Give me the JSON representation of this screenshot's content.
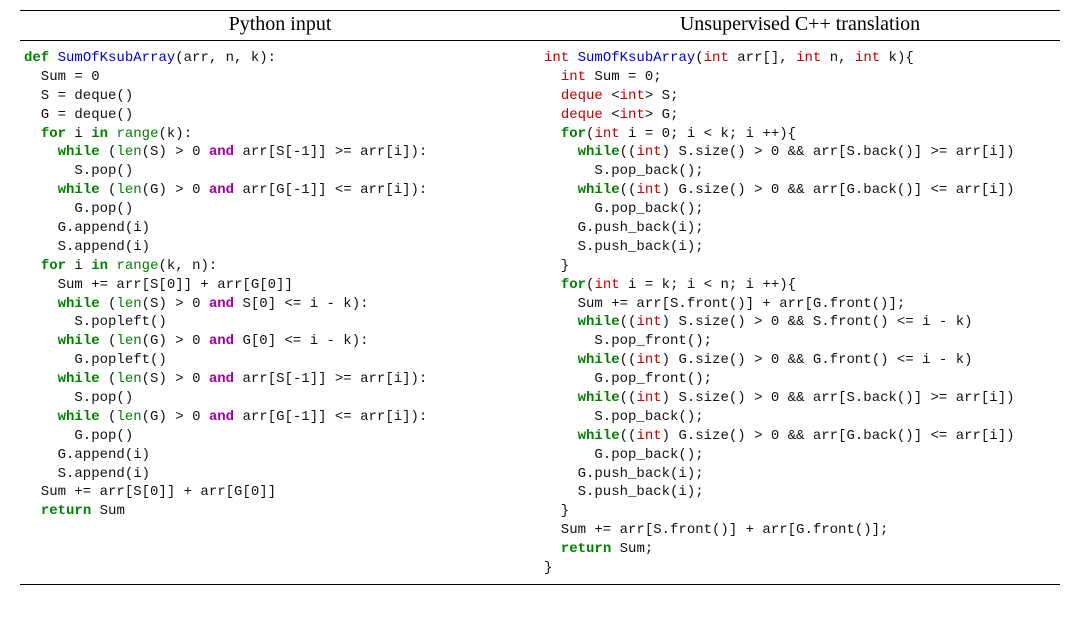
{
  "headers": {
    "left": "Python input",
    "right": "Unsupervised C++ translation"
  },
  "py": {
    "def": "def",
    "for": "for",
    "in": "in",
    "while": "while",
    "and": "and",
    "return": "return",
    "len": "len",
    "range": "range",
    "fn": "SumOfKsubArray",
    "params_open": "(arr, n, k):",
    "l02": "  Sum = 0",
    "l03": "  S = deque()",
    "l04": "  G = deque()",
    "l05_mid": " i ",
    "l05_end": "(k):",
    "l06_cond": "(S) > 0 ",
    "l06_end": " arr[S[-1]] >= arr[i]):",
    "l07": "      S.pop()",
    "l08_cond": "(G) > 0 ",
    "l08_end": " arr[G[-1]] <= arr[i]):",
    "l09": "      G.pop()",
    "l10": "    G.append(i)",
    "l11": "    S.append(i)",
    "l12_end": "(k, n):",
    "l13": "    Sum += arr[S[0]] + arr[G[0]]",
    "l14_cond": "(S) > 0 ",
    "l14_end": " S[0] <= i - k):",
    "l15": "      S.popleft()",
    "l16_cond": "(G) > 0 ",
    "l16_end": " G[0] <= i - k):",
    "l17": "      G.popleft()",
    "l18_cond": "(S) > 0 ",
    "l18_end": " arr[S[-1]] >= arr[i]):",
    "l19": "      S.pop()",
    "l20_cond": "(G) > 0 ",
    "l20_end": " arr[G[-1]] <= arr[i]):",
    "l21": "      G.pop()",
    "l22": "    G.append(i)",
    "l23": "    S.append(i)",
    "l24": "  Sum += arr[S[0]] + arr[G[0]]",
    "l25_end": " Sum"
  },
  "cpp": {
    "int": "int",
    "deque": "deque",
    "for": "for",
    "while": "while",
    "return": "return",
    "fn": "SumOfKsubArray",
    "l01_params": "(",
    "l01_p1t": "int",
    "l01_p1": " arr[], ",
    "l01_p2t": "int",
    "l01_p2": " n, ",
    "l01_p3t": "int",
    "l01_p3": " k){",
    "l02": " Sum = 0;",
    "l03": " <",
    "l03b": "> S;",
    "l04b": "> G;",
    "l05_a": "(",
    "l05_b": " i = 0; i < k; i ++){",
    "l06_a": "((",
    "l06_b": ") S.size() > 0 && arr[S.back()] >= arr[i])",
    "l07": "      S.pop_back();",
    "l08_b": ") G.size() > 0 && arr[G.back()] <= arr[i])",
    "l09": "      G.pop_back();",
    "l10": "    G.push_back(i);",
    "l11": "    S.push_back(i);",
    "l12": "  }",
    "l13_b": " i = k; i < n; i ++){",
    "l14": "    Sum += arr[S.front()] + arr[G.front()];",
    "l15_b": ") S.size() > 0 && S.front() <= i - k)",
    "l16": "      S.pop_front();",
    "l17_b": ") G.size() > 0 && G.front() <= i - k)",
    "l18": "      G.pop_front();",
    "l19_b": ") S.size() > 0 && arr[S.back()] >= arr[i])",
    "l20": "      S.pop_back();",
    "l21_b": ") G.size() > 0 && arr[G.back()] <= arr[i])",
    "l22": "      G.pop_back();",
    "l23": "    G.push_back(i);",
    "l24": "    S.push_back(i);",
    "l25": "  }",
    "l26": "  Sum += arr[S.front()] + arr[G.front()];",
    "l27_end": " Sum;",
    "l28": "}"
  }
}
